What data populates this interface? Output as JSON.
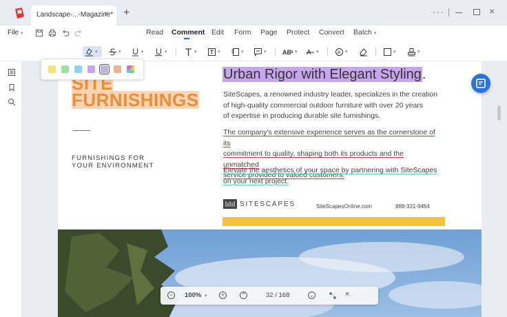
{
  "window": {
    "tab_title": "Landscape-...-Magazine*",
    "tab_close": "×",
    "new_tab": "+",
    "more": "···",
    "close": "×"
  },
  "menu": {
    "file_label": "File",
    "items": [
      "Read",
      "Comment",
      "Edit",
      "Form",
      "Page",
      "Protect",
      "Convert",
      "Batch"
    ],
    "active": "Comment"
  },
  "toolbar": {
    "tools": [
      "highlight-icon",
      "strikethrough-icon",
      "underline-icon",
      "squiggly-underline-icon",
      "text-icon",
      "textbox-icon",
      "callout-icon",
      "note-icon",
      "replace-text-icon",
      "insert-text-icon",
      "stamp-icon",
      "eraser-icon",
      "shape-icon",
      "signature-icon"
    ]
  },
  "highlight_colors": [
    "#f8e16c",
    "#9be3a0",
    "#8fd3ee",
    "#c5a4f2",
    "#b8b4e0",
    "#f1b38e",
    "rainbow"
  ],
  "document": {
    "headline_left_1": "SITE",
    "headline_left_2": "FURNISHINGS",
    "tagline_1": "FURNISHINGS FOR",
    "tagline_2": "YOUR ENVIRONMENT",
    "heading": "Urban Rigor with Elegant Styling",
    "heading_end": ".",
    "para1_lines": [
      "SiteScapes, a renowned industry leader, specializes in the creation",
      "of high-quality commercial outdoor furniture with over 20 years",
      "of expertise in producing durable site furnishings."
    ],
    "para2_lines": [
      "The company's extensive experience serves as the cornerstone of its",
      "commitment to quality, shaping both its products and the unmatched",
      "service provided to valued customers."
    ],
    "para3_lines": [
      "Elevate the aesthetics of your space by partnering with SiteScapes",
      "on your next project."
    ],
    "brand": "SITESCAPES",
    "website": "SiteScapesOnline.com",
    "phone": "888-331-9464"
  },
  "zoom": {
    "level": "100%",
    "page_current": "32",
    "page_separator": "/",
    "page_total": "168"
  }
}
